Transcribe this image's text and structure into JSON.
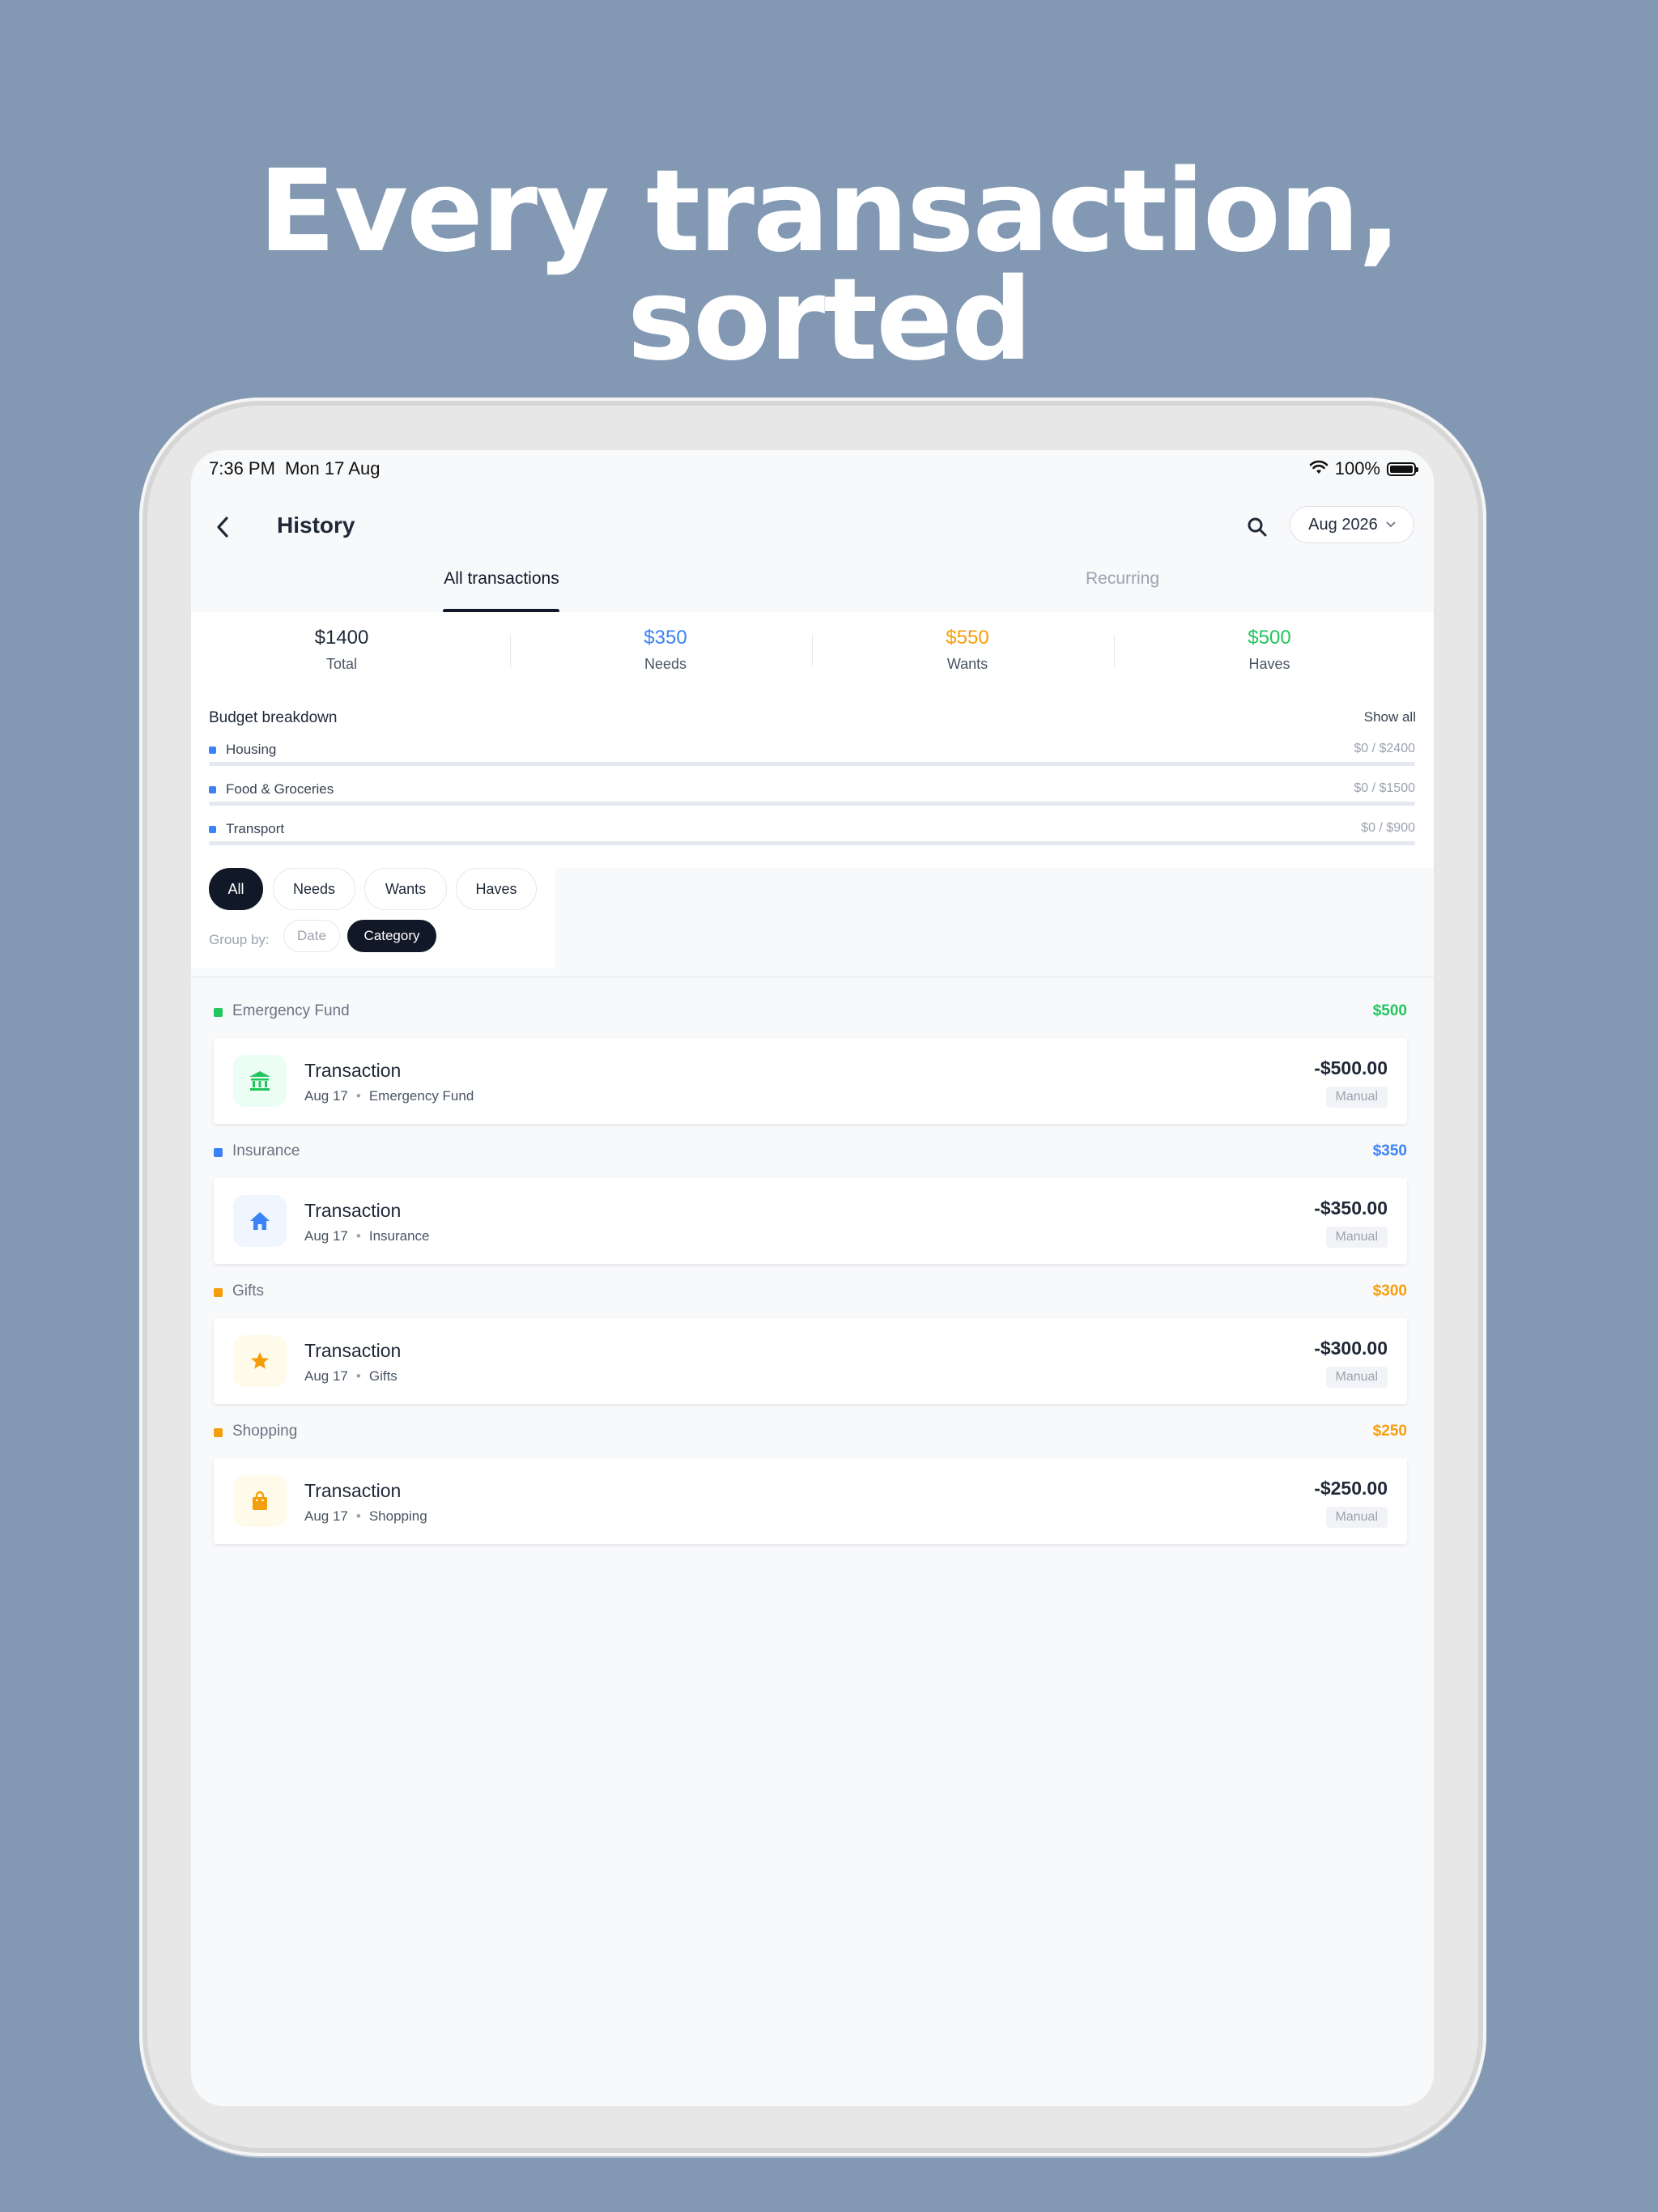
{
  "headline": {
    "line1": "Every transaction,",
    "line2": "sorted"
  },
  "status_bar": {
    "time": "7:36 PM",
    "date": "Mon 17 Aug",
    "battery": "100%"
  },
  "header": {
    "title": "History",
    "month": "Aug 2026",
    "back_icon": "chevron-left-icon",
    "search_icon": "search-icon"
  },
  "tabs": [
    {
      "label": "All transactions",
      "active": true
    },
    {
      "label": "Recurring",
      "active": false
    }
  ],
  "summary": [
    {
      "value": "$1400",
      "label": "Total",
      "color": "#1f2937"
    },
    {
      "value": "$350",
      "label": "Needs",
      "color": "#3b82f6"
    },
    {
      "value": "$550",
      "label": "Wants",
      "color": "#f59e0b"
    },
    {
      "value": "$500",
      "label": "Haves",
      "color": "#22c55e"
    }
  ],
  "budget": {
    "heading": "Budget breakdown",
    "show_all": "Show all",
    "items": [
      {
        "name": "Housing",
        "amount": "$0 / $2400",
        "progress": 0
      },
      {
        "name": "Food & Groceries",
        "amount": "$0 / $1500",
        "progress": 0
      },
      {
        "name": "Transport",
        "amount": "$0 / $900",
        "progress": 0
      }
    ]
  },
  "filters": {
    "types": [
      {
        "label": "All",
        "selected": true
      },
      {
        "label": "Needs",
        "selected": false
      },
      {
        "label": "Wants",
        "selected": false
      },
      {
        "label": "Haves",
        "selected": false
      }
    ],
    "group_by_label": "Group by:",
    "group_options": [
      {
        "label": "Date",
        "selected": false
      },
      {
        "label": "Category",
        "selected": true
      }
    ]
  },
  "groups": [
    {
      "name": "Emergency Fund",
      "total": "$500",
      "color": "#22c55e",
      "icon": "bank-icon",
      "icon_bg": "#ecfdf3",
      "transactions": [
        {
          "title": "Transaction",
          "date": "Aug 17",
          "category": "Emergency Fund",
          "amount": "-$500.00",
          "badge": "Manual"
        }
      ]
    },
    {
      "name": "Insurance",
      "total": "$350",
      "color": "#3b82f6",
      "icon": "home-icon",
      "icon_bg": "#eff6ff",
      "transactions": [
        {
          "title": "Transaction",
          "date": "Aug 17",
          "category": "Insurance",
          "amount": "-$350.00",
          "badge": "Manual"
        }
      ]
    },
    {
      "name": "Gifts",
      "total": "$300",
      "color": "#f59e0b",
      "icon": "star-icon",
      "icon_bg": "#fffbeb",
      "transactions": [
        {
          "title": "Transaction",
          "date": "Aug 17",
          "category": "Gifts",
          "amount": "-$300.00",
          "badge": "Manual"
        }
      ]
    },
    {
      "name": "Shopping",
      "total": "$250",
      "color": "#f59e0b",
      "icon": "shopping-bag-icon",
      "icon_bg": "#fffbeb",
      "transactions": [
        {
          "title": "Transaction",
          "date": "Aug 17",
          "category": "Shopping",
          "amount": "-$250.00",
          "badge": "Manual"
        }
      ]
    }
  ]
}
